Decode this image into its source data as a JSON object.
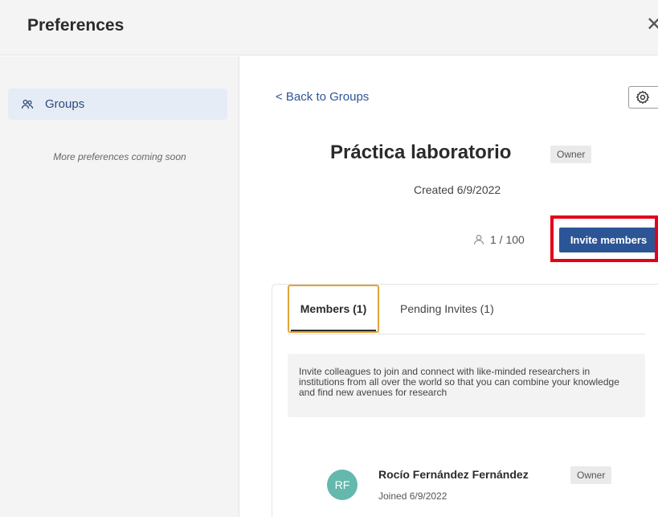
{
  "header": {
    "title": "Preferences",
    "close_icon": "close-icon",
    "close_glyph": "✕"
  },
  "sidebar": {
    "items": [
      {
        "label": "Groups",
        "icon": "users-icon",
        "active": true
      }
    ],
    "coming_soon": "More preferences coming soon"
  },
  "main": {
    "back_link": "< Back to Groups",
    "settings_icon": "gear-icon",
    "group": {
      "name": "Práctica laboratorio",
      "role_badge": "Owner",
      "created": "Created 6/9/2022",
      "member_count": "1 / 100",
      "invite_button": "Invite members"
    },
    "tabs": [
      {
        "label": "Members (1)",
        "active": true
      },
      {
        "label": "Pending Invites (1)",
        "active": false
      }
    ],
    "info_text": "Invite colleagues to join and connect with like-minded researchers in institutions from all over the world so that you can combine your knowledge and find new avenues for research",
    "members": [
      {
        "initials": "RF",
        "name": "Rocío Fernández Fernández",
        "role_badge": "Owner",
        "joined": "Joined 6/9/2022",
        "avatar_color": "#64b8ad"
      }
    ]
  },
  "colors": {
    "accent": "#2c5596",
    "highlight": "#e3001b",
    "tab_focus": "#e0a53a"
  }
}
